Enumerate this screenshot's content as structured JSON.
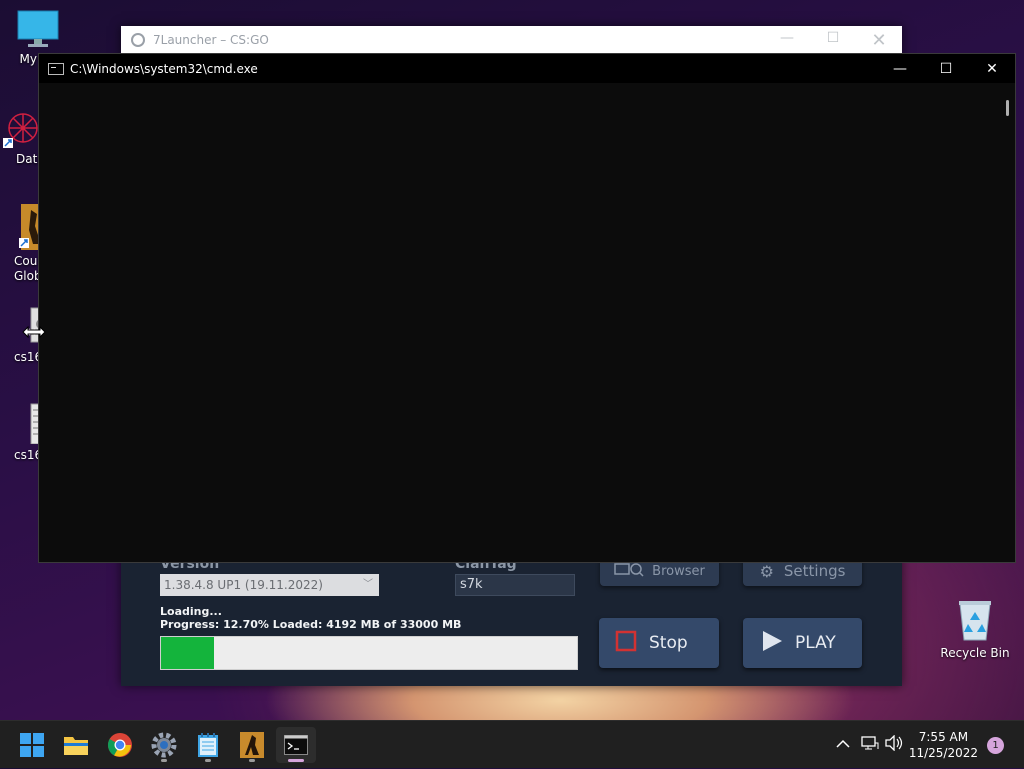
{
  "desktop": {
    "icons": [
      {
        "label": "My Co"
      },
      {
        "label": "DataW"
      },
      {
        "label": "Counte\nGlobal"
      },
      {
        "label": "cs16"
      },
      {
        "label": "cs16"
      }
    ],
    "recycle_bin": {
      "label": "Recycle Bin"
    }
  },
  "launcher": {
    "title": "7Launcher – CS:GO",
    "version_label": "Version",
    "version_value": "1.38.4.8 UP1 (19.11.2022)",
    "clantag_label": "ClanTag",
    "clantag_value": "s7k",
    "browser_label": "Browser",
    "settings_label": "Settings",
    "loading_text": "Loading...",
    "progress_text": "Progress: 12.70% Loaded: 4192 MB of 33000 MB",
    "progress_fraction": 0.127,
    "stop_label": "Stop",
    "play_label": "PLAY"
  },
  "cmd": {
    "title": "C:\\Windows\\system32\\cmd.exe",
    "minimize": "—",
    "maximize": "☐",
    "close": "✕"
  },
  "taskbar": {
    "apps": [
      "start-icon",
      "file-explorer-icon",
      "chrome-icon",
      "settings-icon",
      "notepad-icon",
      "csgo-icon",
      "terminal-icon"
    ],
    "clock_time": "7:55 AM",
    "clock_date": "11/25/2022",
    "notification_count": "1"
  },
  "colors": {
    "progress_fill": "#14b43c",
    "stop_icon": "#d23232",
    "taskbar": "#202020"
  }
}
